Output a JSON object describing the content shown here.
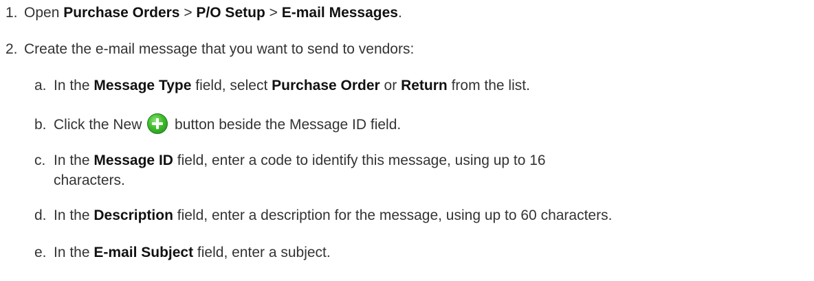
{
  "steps": [
    {
      "number": "1.",
      "prefix": "Open ",
      "menu1": "Purchase Orders",
      "sep1": " > ",
      "menu2": "P/O Setup",
      "sep2": " > ",
      "menu3": "E-mail Messages",
      "suffix": "."
    },
    {
      "number": "2.",
      "text": "Create the e-mail message that you want to send to vendors:"
    }
  ],
  "substeps": [
    {
      "letter": "a.",
      "t1": "In the ",
      "b1": "Message Type",
      "t2": " field, select ",
      "b2": "Purchase Order",
      "t3": " or ",
      "b3": "Return",
      "t4": " from the list."
    },
    {
      "letter": "b.",
      "t1": "Click the New ",
      "icon": "add-plus-icon",
      "t2": " button beside the Message ID field."
    },
    {
      "letter": "c.",
      "t1": "In the ",
      "b1": "Message ID",
      "t2": " field, enter a code to identify this message, using up to 16",
      "line2": "characters."
    },
    {
      "letter": "d.",
      "t1": "In the ",
      "b1": "Description",
      "t2": " field, enter a description for the message, using up to 60 characters."
    },
    {
      "letter": "e.",
      "t1": "In the ",
      "b1": "E-mail Subject",
      "t2": " field, enter a subject."
    }
  ]
}
